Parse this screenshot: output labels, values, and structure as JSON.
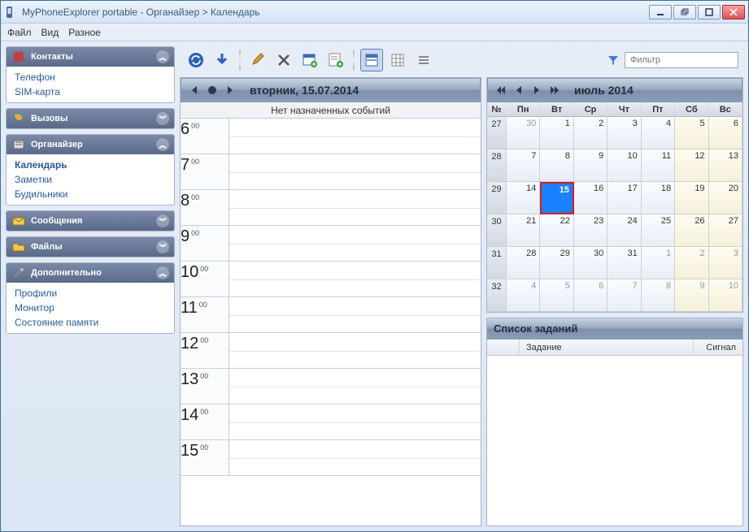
{
  "window": {
    "title": "MyPhoneExplorer portable -  Органайзер > Календарь"
  },
  "menu": {
    "file": "Файл",
    "view": "Вид",
    "misc": "Разное"
  },
  "filter": {
    "placeholder": "Фильтр"
  },
  "sidebar": {
    "contacts": {
      "title": "Контакты",
      "items": [
        "Телефон",
        "SIM-карта"
      ]
    },
    "calls": {
      "title": "Вызовы"
    },
    "organizer": {
      "title": "Органайзер",
      "items": [
        "Календарь",
        "Заметки",
        "Будильники"
      ],
      "active": 0
    },
    "messages": {
      "title": "Сообщения"
    },
    "files": {
      "title": "Файлы"
    },
    "extra": {
      "title": "Дополнительно",
      "items": [
        "Профили",
        "Монитор",
        "Состояние памяти"
      ]
    }
  },
  "day": {
    "title": "вторник, 15.07.2014",
    "no_events": "Нет назначенных событий",
    "hours": [
      6,
      7,
      8,
      9,
      10,
      11,
      12,
      13,
      14,
      15
    ]
  },
  "month": {
    "title": "июль 2014",
    "wk_label": "№",
    "dow": [
      "Пн",
      "Вт",
      "Ср",
      "Чт",
      "Пт",
      "Сб",
      "Вс"
    ],
    "weeks": [
      {
        "wk": 27,
        "days": [
          {
            "n": 30,
            "o": 1
          },
          {
            "n": 1
          },
          {
            "n": 2
          },
          {
            "n": 3
          },
          {
            "n": 4
          },
          {
            "n": 5,
            "w": 1
          },
          {
            "n": 6,
            "w": 1
          }
        ]
      },
      {
        "wk": 28,
        "days": [
          {
            "n": 7
          },
          {
            "n": 8
          },
          {
            "n": 9
          },
          {
            "n": 10
          },
          {
            "n": 11
          },
          {
            "n": 12,
            "w": 1
          },
          {
            "n": 13,
            "w": 1
          }
        ]
      },
      {
        "wk": 29,
        "days": [
          {
            "n": 14
          },
          {
            "n": 15,
            "t": 1
          },
          {
            "n": 16
          },
          {
            "n": 17
          },
          {
            "n": 18
          },
          {
            "n": 19,
            "w": 1
          },
          {
            "n": 20,
            "w": 1
          }
        ]
      },
      {
        "wk": 30,
        "days": [
          {
            "n": 21
          },
          {
            "n": 22
          },
          {
            "n": 23
          },
          {
            "n": 24
          },
          {
            "n": 25
          },
          {
            "n": 26,
            "w": 1
          },
          {
            "n": 27,
            "w": 1
          }
        ]
      },
      {
        "wk": 31,
        "days": [
          {
            "n": 28
          },
          {
            "n": 29
          },
          {
            "n": 30
          },
          {
            "n": 31
          },
          {
            "n": 1,
            "o": 1
          },
          {
            "n": 2,
            "o": 1,
            "w": 1
          },
          {
            "n": 3,
            "o": 1,
            "w": 1
          }
        ]
      },
      {
        "wk": 32,
        "days": [
          {
            "n": 4,
            "o": 1
          },
          {
            "n": 5,
            "o": 1
          },
          {
            "n": 6,
            "o": 1
          },
          {
            "n": 7,
            "o": 1
          },
          {
            "n": 8,
            "o": 1
          },
          {
            "n": 9,
            "o": 1,
            "w": 1
          },
          {
            "n": 10,
            "o": 1,
            "w": 1
          }
        ]
      }
    ]
  },
  "tasks": {
    "title": "Список заданий",
    "cols": {
      "task": "Задание",
      "signal": "Сигнал"
    }
  }
}
